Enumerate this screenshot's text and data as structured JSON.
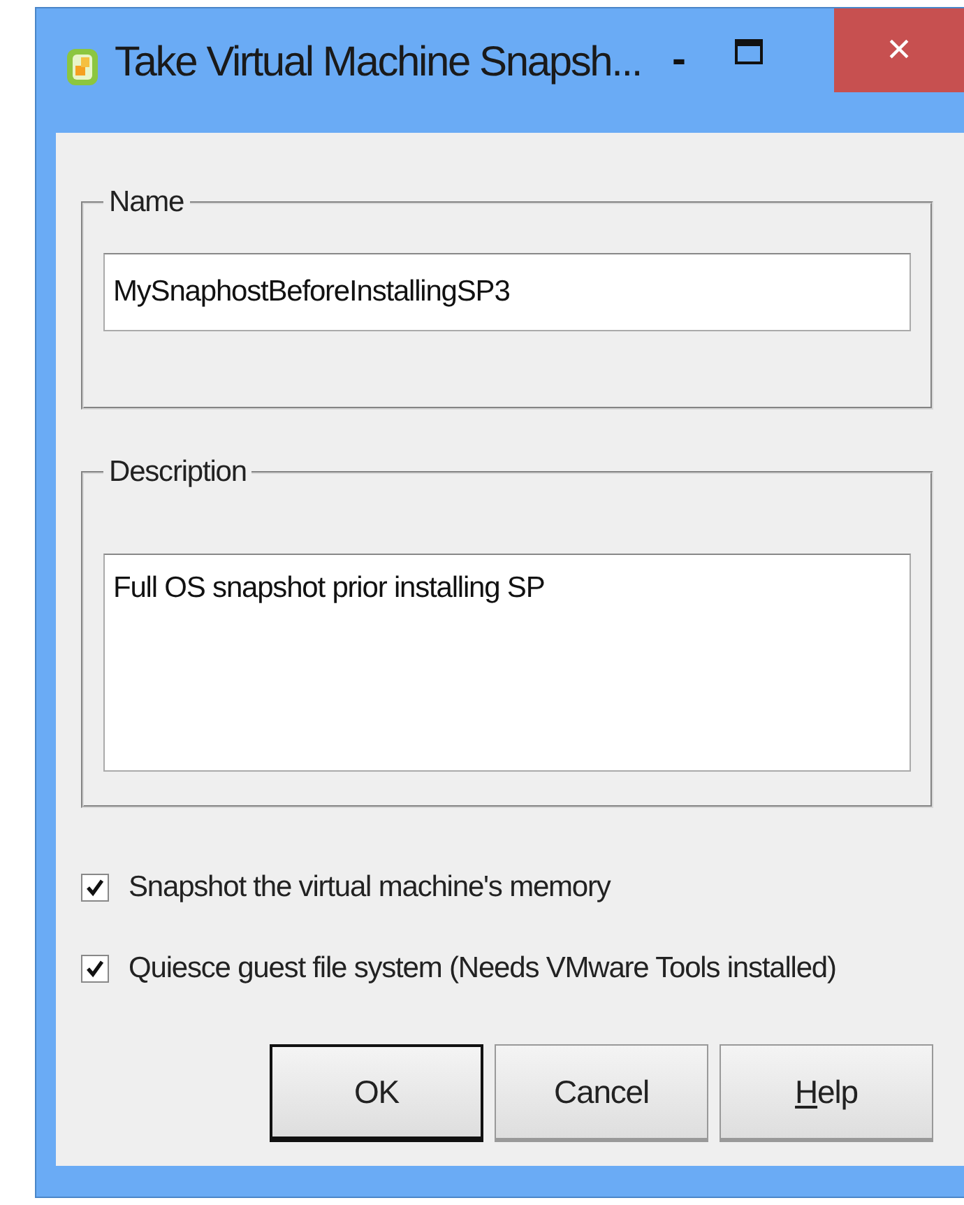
{
  "window": {
    "title": "Take Virtual Machine Snapsh...",
    "controls": [
      "-",
      "×"
    ]
  },
  "name_group": {
    "legend": "Name",
    "value": "MySnaphostBeforeInstallingSP3"
  },
  "description_group": {
    "legend": "Description",
    "value": "Full OS snapshot prior installing SP"
  },
  "options": [
    {
      "label": "Snapshot the virtual machine's memory",
      "checked": true
    },
    {
      "label": "Quiesce guest file system (Needs VMware Tools installed)",
      "checked": true
    }
  ],
  "buttons": [
    {
      "label": "OK",
      "default": true,
      "underline_first": false
    },
    {
      "label": "Cancel",
      "default": false,
      "underline_first": false
    },
    {
      "label": "Help",
      "default": false,
      "underline_first": true
    }
  ]
}
